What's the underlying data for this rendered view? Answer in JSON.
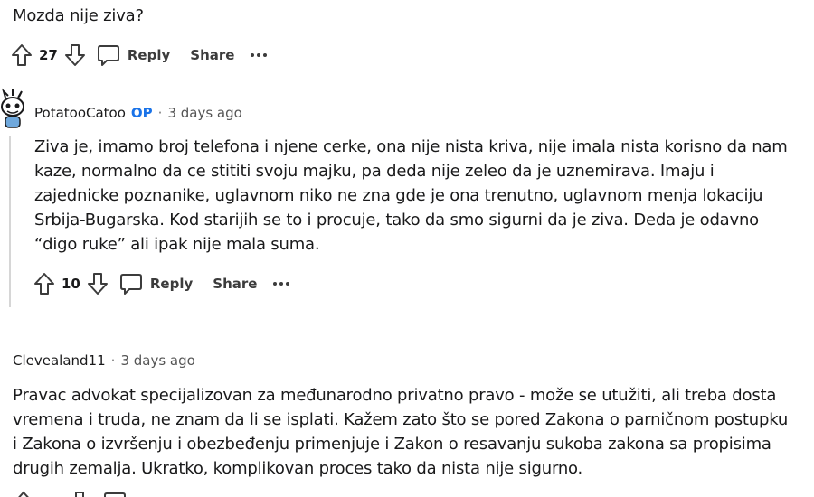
{
  "top_comment": {
    "text": "Mozda nije ziva?",
    "votes": "27",
    "reply_label": "Reply",
    "share_label": "Share"
  },
  "reply_comment": {
    "username": "PotatooCatoo",
    "op_badge": "OP",
    "time": "3 days ago",
    "lines": [
      "Ziva je, imamo broj telefona i njene cerke, ona nije nista kriva, nije imala nista korisno da nam",
      "kaze, normalno da ce stititi svoju majku, pa deda nije zeleo da je uznemirava. Imaju i",
      "zajednicke poznanike, uglavnom niko ne zna gde je ona trenutno, uglavnom menja lokaciju",
      "Srbija-Bugarska. Kod starijih se to i procuje, tako da smo sigurni da je ziva. Deda je odavno",
      "“digo ruke” ali ipak nije mala suma."
    ],
    "votes": "10",
    "reply_label": "Reply",
    "share_label": "Share"
  },
  "third_comment": {
    "username": "Clevealand11",
    "time": "3 days ago",
    "lines": [
      "Pravac advokat specijalizovan za međunarodno privatno pravo - može se utužiti, ali treba dosta",
      "vremena i truda, ne znam da li se isplati. Kažem zato što se pored Zakona o parničnom postupku",
      "i Zakona o izvršenju i obezbeđenju primenjuje i Zakon o resavanju sukoba zakona sa propisima",
      "drugih zemalja. Ukratko, komplikovan proces tako da nista nije sigurno."
    ]
  },
  "icons": {
    "upvote": "upvote-arrow-icon",
    "downvote": "downvote-arrow-icon",
    "reply": "speech-bubble-icon",
    "more": "ellipsis-icon",
    "avatar": "snoo-avatar-icon"
  }
}
